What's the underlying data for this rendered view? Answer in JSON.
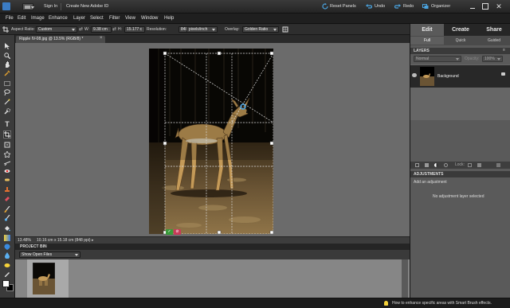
{
  "titlebar": {
    "sign_in": "Sign In",
    "create_id": "Create New Adobe ID",
    "reset_panels": "Reset Panels",
    "undo": "Undo",
    "redo": "Redo",
    "organizer": "Organizer"
  },
  "menu": [
    "File",
    "Edit",
    "Image",
    "Enhance",
    "Layer",
    "Select",
    "Filter",
    "View",
    "Window",
    "Help"
  ],
  "options": {
    "aspect_label": "Aspect Ratio:",
    "aspect_value": "Custom",
    "w_label": "W:",
    "w_value": "9.38 cm",
    "h_label": "H:",
    "h_value": "15.177 c",
    "res_label": "Resolution:",
    "res_value": "848",
    "res_unit": "pixels/inch",
    "overlay_label": "Overlay:",
    "overlay_value": "Golden Ratio"
  },
  "document": {
    "tab_title": "Ripple IV-08.jpg @ 13.5% (RGB/8) *",
    "zoom": "13.48%",
    "info": "10.16 cm x 15.18 cm (848 ppi)"
  },
  "project_bin": {
    "title": "PROJECT BIN",
    "dropdown": "Show Open Files"
  },
  "right_panel": {
    "tabs": [
      "Edit",
      "Create",
      "Share"
    ],
    "subtabs": [
      "Full",
      "Quick",
      "Guided"
    ],
    "layers_title": "LAYERS",
    "blend_mode": "Normal",
    "opacity_label": "Opacity:",
    "opacity_value": "100%",
    "layer_name": "Background",
    "lock_label": "Lock:",
    "adjustments_title": "ADJUSTMENTS",
    "add_adjustment": "Add an adjustment",
    "no_adjustment": "No adjustment layer selected"
  },
  "tip": "How to enhance specific areas with Smart Brush effects.",
  "colors": {
    "accent": "#4aa3df",
    "panel": "#5a5a5a",
    "canvas": "#6b6b6b"
  }
}
